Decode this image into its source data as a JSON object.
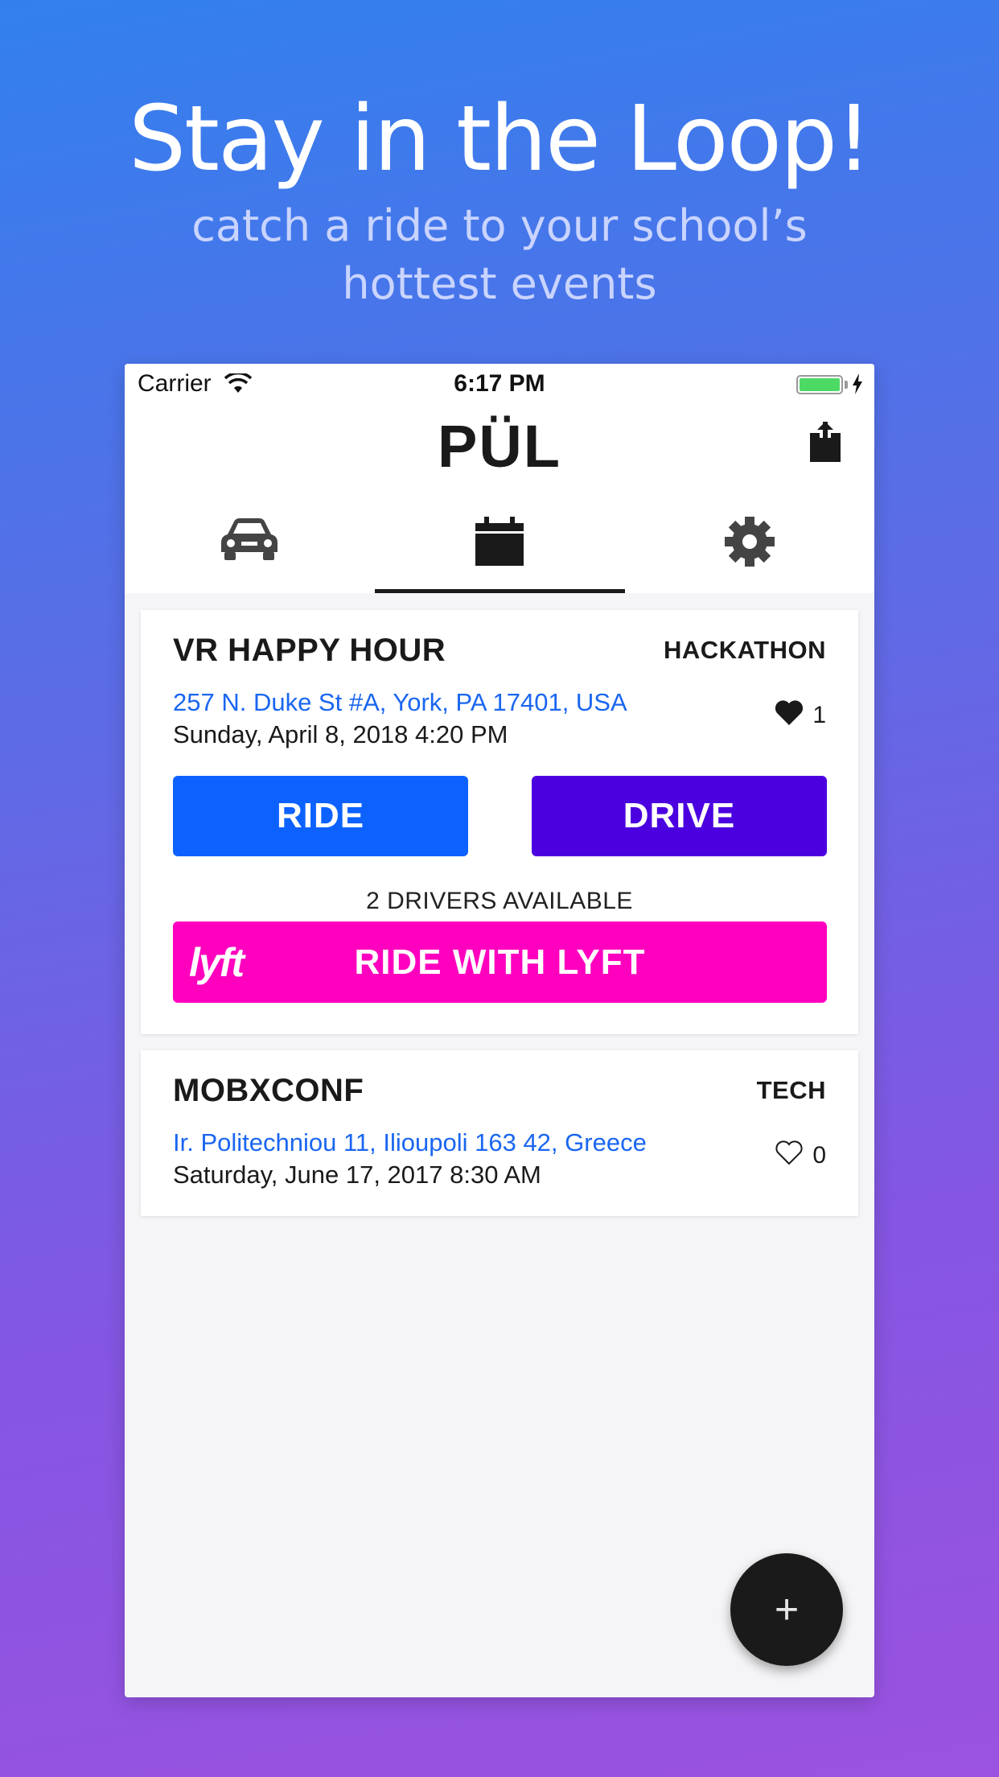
{
  "hero": {
    "headline": "Stay in the Loop!",
    "subline": "catch a ride to your school’s hottest events"
  },
  "status_bar": {
    "carrier": "Carrier",
    "time": "6:17 PM"
  },
  "app": {
    "logo": "PÜL",
    "tabs": [
      {
        "icon": "car-icon",
        "active": false
      },
      {
        "icon": "calendar-icon",
        "active": true
      },
      {
        "icon": "gear-icon",
        "active": false
      }
    ]
  },
  "events": [
    {
      "title": "VR HAPPY HOUR",
      "tag": "HACKATHON",
      "address": "257 N. Duke St #A, York, PA 17401, USA",
      "date": "Sunday, April 8, 2018 4:20 PM",
      "likes": "1",
      "liked": true,
      "ride_label": "RIDE",
      "drive_label": "DRIVE",
      "drivers_text": "2 DRIVERS AVAILABLE",
      "lyft_label": "RIDE WITH LYFT",
      "lyft_logo": "lyft"
    },
    {
      "title": "MOBXCONF",
      "tag": "TECH",
      "address": "Ir. Politechniou 11, Ilioupoli 163 42, Greece",
      "date": "Saturday, June 17, 2017 8:30 AM",
      "likes": "0",
      "liked": false
    }
  ],
  "fab": {
    "label": "+"
  },
  "colors": {
    "ride": "#0d62ff",
    "drive": "#4b00e0",
    "lyft": "#ff00bf",
    "address": "#1a66f0",
    "battery": "#4cd964"
  }
}
